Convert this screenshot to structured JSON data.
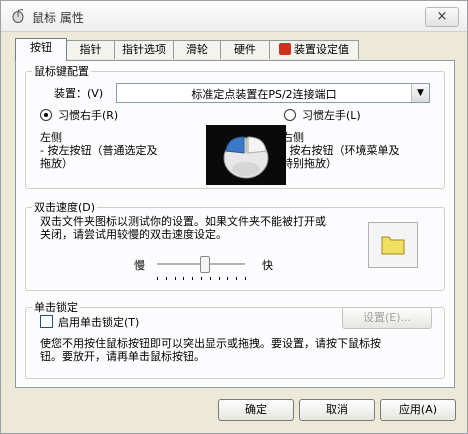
{
  "window": {
    "title": "鼠标 属性",
    "close_label": "×"
  },
  "tabs": [
    {
      "label": "按钮"
    },
    {
      "label": "指针"
    },
    {
      "label": "指针选项"
    },
    {
      "label": "滑轮"
    },
    {
      "label": "硬件"
    },
    {
      "label": "装置设定值"
    }
  ],
  "button_config": {
    "group_title": "鼠标键配置",
    "device_label": "装置：(V)",
    "device_value": "标准定点装置在PS/2连接端口",
    "right_handed_label": "习惯右手(R)",
    "left_handed_label": "习惯左手(L)",
    "right_handed_checked": true,
    "left_side_title": "左侧",
    "left_side_desc_1": "- 按左按钮（普通选定及",
    "left_side_desc_2": "拖放）",
    "right_side_title": "右侧",
    "right_side_desc_1": "- 按右按钮（环境菜单及",
    "right_side_desc_2": "特别拖放）"
  },
  "double_click": {
    "group_title": "双击速度(D)",
    "desc_1": "双击文件夹图标以测试你的设置。如果文件夹不能被打开或",
    "desc_2": "关闭，请尝试用较慢的双击速度设定。",
    "slow_label": "慢",
    "fast_label": "快",
    "speed_level": 0.55
  },
  "click_lock": {
    "group_title": "单击锁定",
    "enable_label": "启用单击锁定(T)",
    "enabled": false,
    "settings_button": "设置(E)...",
    "desc_1": "使您不用按住鼠标按钮即可以突出显示或拖拽。要设置，请按下鼠标按",
    "desc_2": "钮。要放开，请再单击鼠标按钮。"
  },
  "footer": {
    "ok": "确定",
    "cancel": "取消",
    "apply": "应用(A)"
  },
  "colors": {
    "dialog_bg": "#ece9d8",
    "panel_bg": "#fcfcfe",
    "folder": "#f0e060"
  }
}
